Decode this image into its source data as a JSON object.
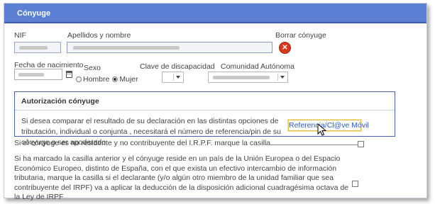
{
  "panel": {
    "title": "Cónyuge"
  },
  "fields": {
    "nif_label": "NIF",
    "nombre_label": "Apellidos y nombre",
    "borrar_label": "Borrar cónyuge",
    "fecha_label": "Fecha de nacimiento",
    "sexo_label": "Sexo",
    "sexo_options": [
      "Hombre",
      "Mujer"
    ],
    "sexo_selected": "Mujer",
    "discapacidad_label": "Clave de discapacidad",
    "comunidad_label": "Comunidad Autónoma"
  },
  "auth": {
    "title": "Autorización cónyuge",
    "text": "Si desea comparar el resultado de su declaración en las distintas opciones de tributación, individual o conjunta , necesitará el número de referencia/pin de su cónyuge o ser apoderado",
    "button_label": "Referencia/Cl@ve Móvil"
  },
  "no_residente": {
    "text": "Si el cónyuge es no residente y no contribuyente del I.R.P.F. marque la casilla",
    "checked": false
  },
  "ue": {
    "text": "Si ha marcado la casilla anterior y el cónyuge reside en un país de la Unión Europea o del Espacio Económico Europeo, distinto de España, con el que exista un efectivo intercambio de información tributaria, marque la casilla si el declarante (y/o algún otro miembro de la unidad familiar que sea contribuyente del IRPF) va a aplicar la deducción de la disposición adicional cuadragésima octava de la Ley de IRPF",
    "checked": false
  },
  "colors": {
    "header": "#5b7fd3",
    "auth_border": "#4a5fb0",
    "link": "#2b58c9",
    "highlight": "#e4c24a",
    "delete": "#d9381e"
  }
}
